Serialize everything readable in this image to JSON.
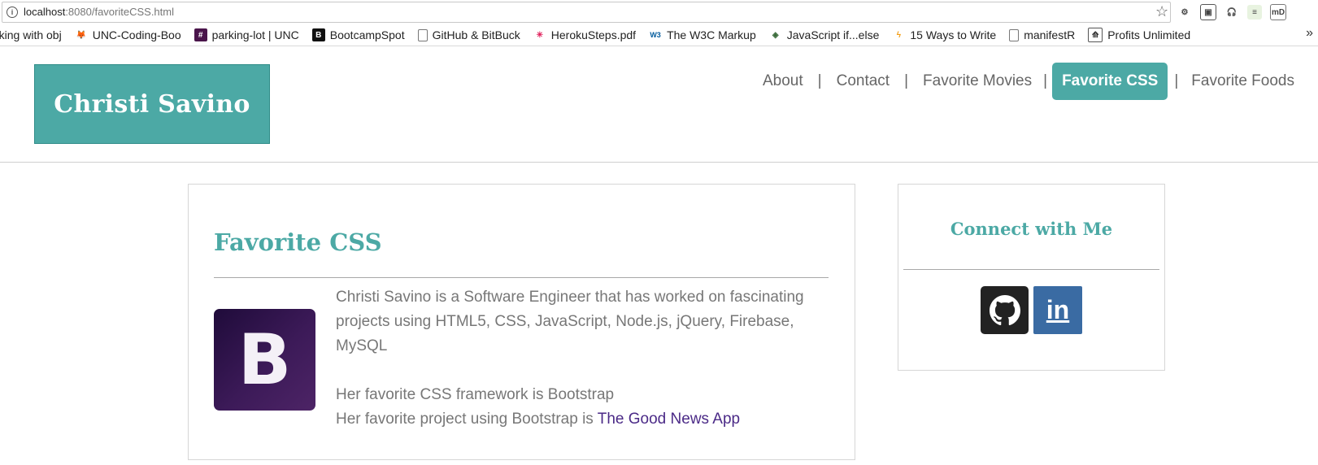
{
  "browser": {
    "url_host": "localhost",
    "url_path": ":8080/favoriteCSS.html",
    "bookmarks": [
      {
        "label": "rking with obj",
        "icon": "bookmark-page-icon"
      },
      {
        "label": "UNC-Coding-Boo",
        "icon": "gitlab-icon"
      },
      {
        "label": "parking-lot | UNC",
        "icon": "slack-hash-icon"
      },
      {
        "label": "BootcampSpot",
        "icon": "bootcampspot-icon"
      },
      {
        "label": "GitHub & BitBuck",
        "icon": "page-icon"
      },
      {
        "label": "HerokuSteps.pdf",
        "icon": "slack-icon"
      },
      {
        "label": "The W3C Markup",
        "icon": "w3c-icon"
      },
      {
        "label": "JavaScript if...else",
        "icon": "diamond-icon"
      },
      {
        "label": "15 Ways to Write",
        "icon": "lightning-icon"
      },
      {
        "label": "manifestR",
        "icon": "page-icon"
      },
      {
        "label": "Profits Unlimited",
        "icon": "profits-icon"
      }
    ],
    "more_glyph": "»"
  },
  "header": {
    "logo_text": "Christi Savino",
    "nav": {
      "about": "About",
      "contact": "Contact",
      "movies": "Favorite Movies",
      "css": "Favorite CSS",
      "foods": "Favorite Foods",
      "separator": "|"
    }
  },
  "main": {
    "title": "Favorite CSS",
    "logo_letter": "B",
    "bio_line1": "Christi Savino is a Software Engineer that has worked on fascinating projects using HTML5, CSS, JavaScript, Node.js, jQuery, Firebase, MySQL",
    "bio_line2": "Her favorite CSS framework is Bootstrap",
    "bio_line3_prefix": "Her favorite project using Bootstrap is ",
    "bio_link": "The Good News App"
  },
  "sidebar": {
    "title": "Connect with Me",
    "linkedin_label": "in"
  },
  "colors": {
    "accent": "#4ca9a5",
    "link": "#4b2a87"
  }
}
